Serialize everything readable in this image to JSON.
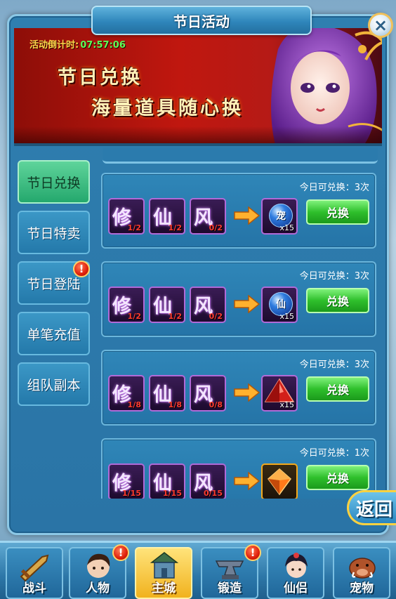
{
  "window": {
    "title": "节日活动"
  },
  "close": {
    "icon": "×"
  },
  "banner": {
    "countdown_label": "活动倒计时:",
    "countdown_time": "07:57:06",
    "headline1": "节日兑换",
    "headline2": "海量道具随心换"
  },
  "tabs": [
    {
      "label": "节日兑换",
      "active": true,
      "badge": false
    },
    {
      "label": "节日特卖",
      "active": false,
      "badge": false
    },
    {
      "label": "节日登陆",
      "active": false,
      "badge": true
    },
    {
      "label": "单笔充值",
      "active": false,
      "badge": false
    },
    {
      "label": "组队副本",
      "active": false,
      "badge": false
    }
  ],
  "badge_text": "!",
  "rows": [
    {
      "quota": "今日可兑换：3次",
      "inputs": [
        {
          "glyph": "修",
          "count": "1/2"
        },
        {
          "glyph": "仙",
          "count": "1/2"
        },
        {
          "glyph": "风",
          "count": "0/2"
        }
      ],
      "reward": {
        "type": "orb",
        "glyph": "宠",
        "count": "x15"
      },
      "button": "兑换"
    },
    {
      "quota": "今日可兑换：3次",
      "inputs": [
        {
          "glyph": "修",
          "count": "1/2"
        },
        {
          "glyph": "仙",
          "count": "1/2"
        },
        {
          "glyph": "风",
          "count": "0/2"
        }
      ],
      "reward": {
        "type": "orb",
        "glyph": "仙",
        "count": "x15"
      },
      "button": "兑换"
    },
    {
      "quota": "今日可兑换：3次",
      "inputs": [
        {
          "glyph": "修",
          "count": "1/8"
        },
        {
          "glyph": "仙",
          "count": "1/8"
        },
        {
          "glyph": "风",
          "count": "0/8"
        }
      ],
      "reward": {
        "type": "red-gem",
        "glyph": "",
        "count": "x15"
      },
      "button": "兑换"
    },
    {
      "quota": "今日可兑换：1次",
      "inputs": [
        {
          "glyph": "修",
          "count": "1/15"
        },
        {
          "glyph": "仙",
          "count": "1/15"
        },
        {
          "glyph": "风",
          "count": "0/15"
        }
      ],
      "reward": {
        "type": "gold-gem",
        "glyph": "",
        "count": ""
      },
      "button": "兑换"
    }
  ],
  "return_button": "返回",
  "bottom_nav": [
    {
      "label": "战斗",
      "icon": "sword-icon",
      "active": false,
      "badge": false
    },
    {
      "label": "人物",
      "icon": "hero-portrait-icon",
      "active": false,
      "badge": true
    },
    {
      "label": "主城",
      "icon": "city-icon",
      "active": true,
      "badge": false
    },
    {
      "label": "锻造",
      "icon": "anvil-icon",
      "active": false,
      "badge": true
    },
    {
      "label": "仙侣",
      "icon": "fairy-portrait-icon",
      "active": false,
      "badge": false
    },
    {
      "label": "宠物",
      "icon": "boar-pet-icon",
      "active": false,
      "badge": false
    }
  ],
  "colors": {
    "accent_green": "#2fbf2c",
    "countdown_time": "#5cff57",
    "countdown_label": "#ffd84a",
    "count_red": "#ff3b2f",
    "badge_red": "#e0200c"
  }
}
